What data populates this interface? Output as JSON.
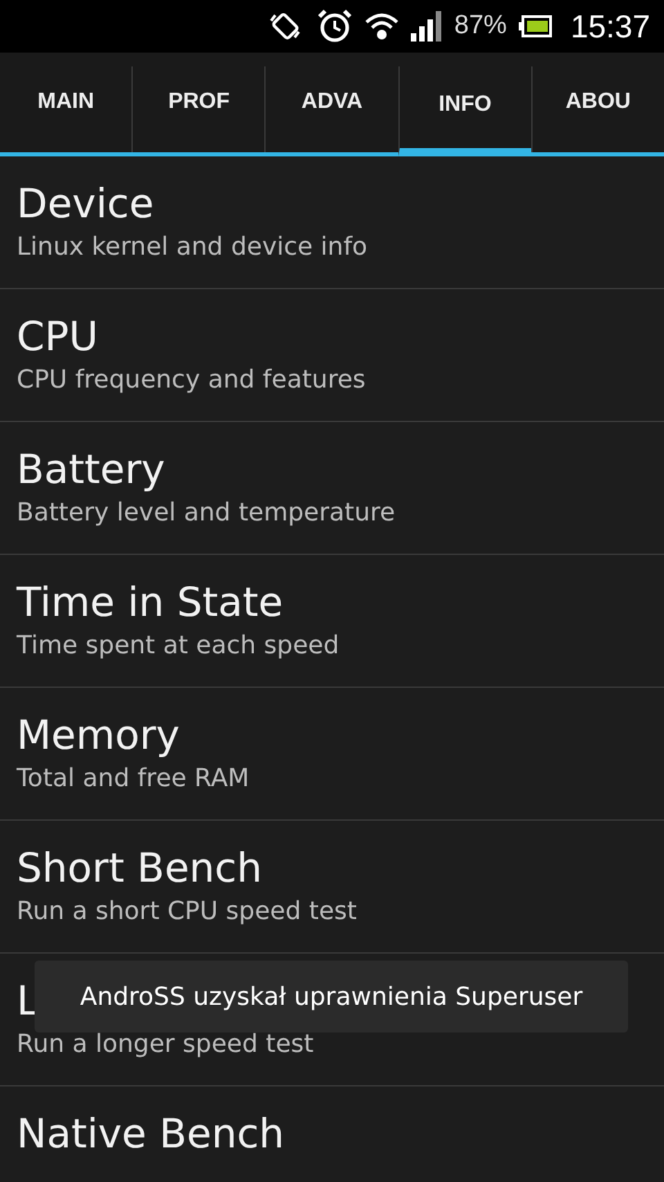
{
  "status_bar": {
    "battery_percent": "87%",
    "time": "15:37"
  },
  "tabs": [
    {
      "label": "MAIN",
      "selected": false
    },
    {
      "label": "PROF",
      "selected": false
    },
    {
      "label": "ADVA",
      "selected": false
    },
    {
      "label": "INFO",
      "selected": true
    },
    {
      "label": "ABOU",
      "selected": false
    }
  ],
  "items": [
    {
      "title": "Device",
      "subtitle": "Linux kernel and device info"
    },
    {
      "title": "CPU",
      "subtitle": "CPU frequency and features"
    },
    {
      "title": "Battery",
      "subtitle": "Battery level and temperature"
    },
    {
      "title": "Time in State",
      "subtitle": "Time spent at each speed"
    },
    {
      "title": "Memory",
      "subtitle": "Total and free RAM"
    },
    {
      "title": "Short Bench",
      "subtitle": "Run a short CPU speed test"
    },
    {
      "title": "L",
      "subtitle": "Run a longer speed test"
    },
    {
      "title": "Native Bench"
    }
  ],
  "toast": {
    "text": "AndroSS uzyskał uprawnienia Superuser"
  }
}
